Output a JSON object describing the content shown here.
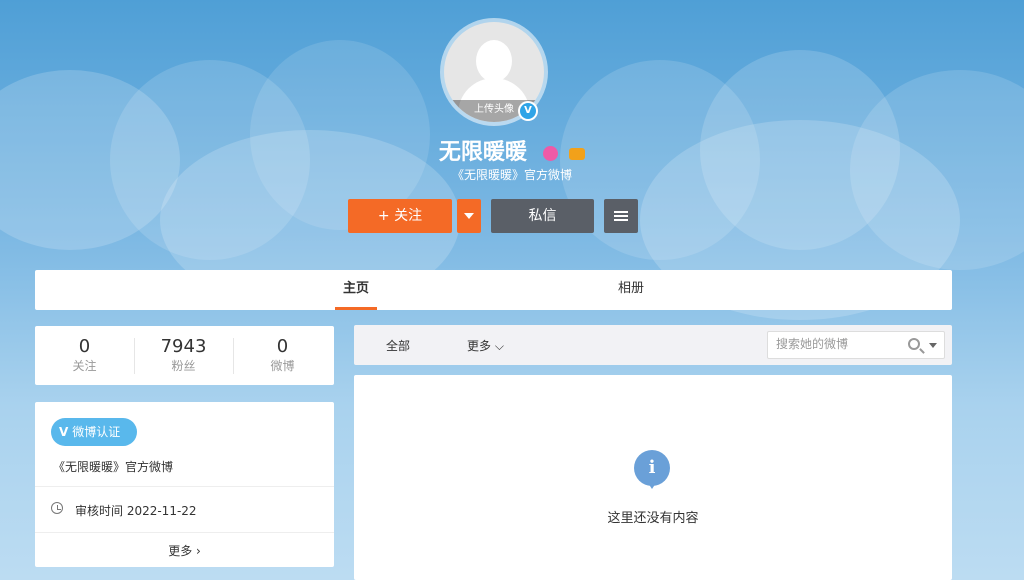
{
  "profile": {
    "name": "无限暖暖",
    "subtitle": "《无限暖暖》官方微博",
    "upload_avatar": "上传头像",
    "verified_mark": "V"
  },
  "actions": {
    "follow_label": "+ 关注",
    "message_label": "私信"
  },
  "tabs": [
    {
      "label": "主页",
      "active": true
    },
    {
      "label": "相册",
      "active": false
    }
  ],
  "stats": [
    {
      "value": "0",
      "label": "关注"
    },
    {
      "value": "7943",
      "label": "粉丝"
    },
    {
      "value": "0",
      "label": "微博"
    }
  ],
  "info": {
    "verify_badge": "微博认证",
    "verify_badge_mark": "V",
    "verify_text": "《无限暖暖》官方微博",
    "review_time": "审核时间 2022-11-22",
    "more_label": "更多 ›"
  },
  "feed": {
    "filter_all": "全部",
    "filter_more": "更多 ⌵",
    "search_placeholder": "搜索她的微博",
    "empty_text": "这里还没有内容",
    "empty_icon_glyph": "i"
  },
  "colors": {
    "accent": "#f46a26",
    "dark_button": "#5a5f67",
    "verify_blue": "#59b8ec",
    "info_blue": "#6aa0d8"
  }
}
